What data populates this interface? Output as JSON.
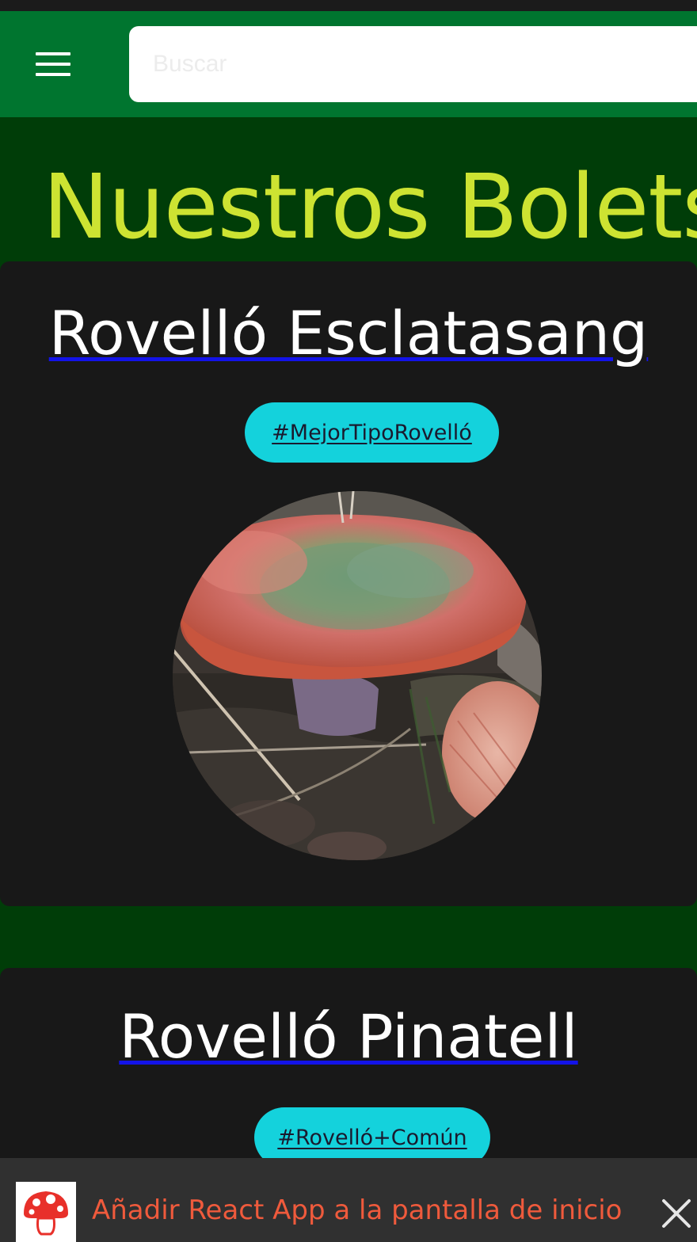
{
  "header": {
    "menu_icon": "hamburger-menu-icon",
    "search_placeholder": "Buscar"
  },
  "page": {
    "title": "Nuestros Bolets"
  },
  "bolets": [
    {
      "name": "Rovelló Esclatasang",
      "tag": "#MejorTipoRovelló",
      "image": "mushroom-photo"
    },
    {
      "name": "Rovelló Pinatell",
      "tag": "#Rovelló+Común"
    }
  ],
  "install_banner": {
    "icon": "mushroom-icon",
    "text": "Añadir React App a la pantalla de inicio",
    "close_icon": "close-icon"
  },
  "colors": {
    "app_bar": "#00752f",
    "page_background": "#003d08",
    "card_background": "#181818",
    "title": "#cde332",
    "tag_background": "#14d2dc",
    "link_underline": "#1313e8",
    "banner_text": "#ef5a3c",
    "banner_background": "#303030"
  }
}
